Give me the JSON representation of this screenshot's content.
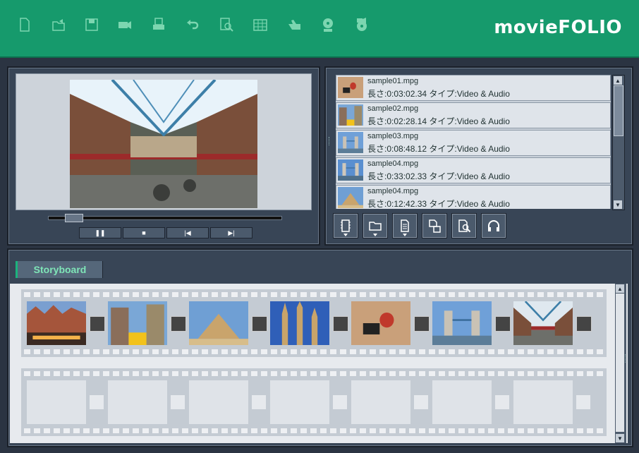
{
  "app": {
    "logo": "movieFOLIO"
  },
  "toolbar": {
    "icons": [
      "new-file-icon",
      "open-file-icon",
      "save-icon",
      "video-camera-icon",
      "print-icon",
      "undo-icon",
      "preview-icon",
      "calendar-grid-icon",
      "pointer-hand-icon",
      "dvd-icon",
      "disc-camera-icon"
    ]
  },
  "player": {
    "seek_progress": 0.07
  },
  "file_list": {
    "items": [
      {
        "name": "sample01.mpg",
        "meta": "長さ:0:03:02.34  タイプ:Video & Audio",
        "thumb": "bullfight"
      },
      {
        "name": "sample02.mpg",
        "meta": "長さ:0:02:28.14  タイプ:Video & Audio",
        "thumb": "street"
      },
      {
        "name": "sample03.mpg",
        "meta": "長さ:0:08:48.12  タイプ:Video & Audio",
        "thumb": "bridge"
      },
      {
        "name": "sample04.mpg",
        "meta": "長さ:0:33:02.33  タイプ:Video & Audio",
        "thumb": "bridge2"
      },
      {
        "name": "sample04.mpg",
        "meta": "長さ:0:12:42.33  タイプ:Video & Audio",
        "thumb": "pyramid"
      }
    ]
  },
  "storyboard": {
    "tab_label": "Storyboard",
    "frames": [
      "houses",
      "street",
      "pyramid",
      "cathedral",
      "bullfight",
      "bridge",
      "market"
    ]
  },
  "colors": {
    "brand_green": "#169a6c",
    "panel": "#384556",
    "tab_text": "#7fe6b8"
  }
}
